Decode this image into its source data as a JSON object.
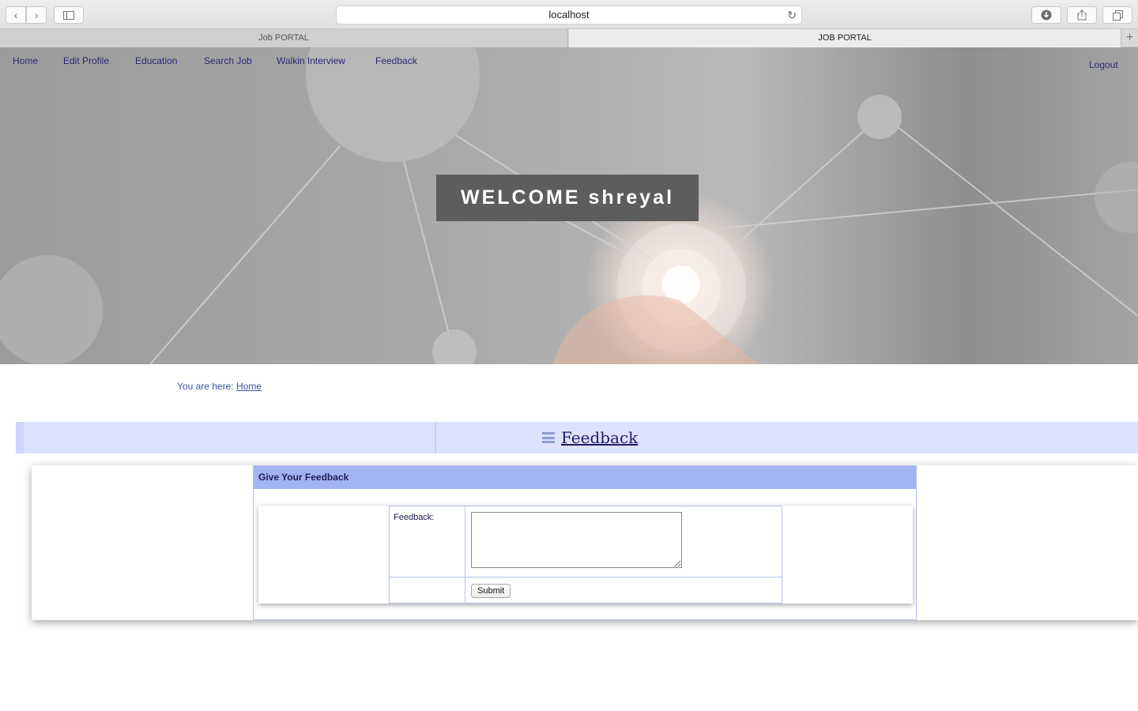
{
  "browser": {
    "url": "localhost",
    "tabs": [
      "Job PORTAL",
      "JOB PORTAL"
    ]
  },
  "nav": {
    "items": [
      "Home",
      "Edit Profile",
      "Education",
      "Search Job",
      "Walkin Interview",
      "Feedback"
    ],
    "logout": "Logout"
  },
  "hero": {
    "welcome": "WELCOME shreyal"
  },
  "breadcrumb": {
    "prefix": "You are here:",
    "link": "Home"
  },
  "page": {
    "title": "Feedback"
  },
  "form": {
    "heading": "Give Your Feedback",
    "feedback_label": "Feedback:",
    "feedback_value": "",
    "submit_label": "Submit"
  }
}
